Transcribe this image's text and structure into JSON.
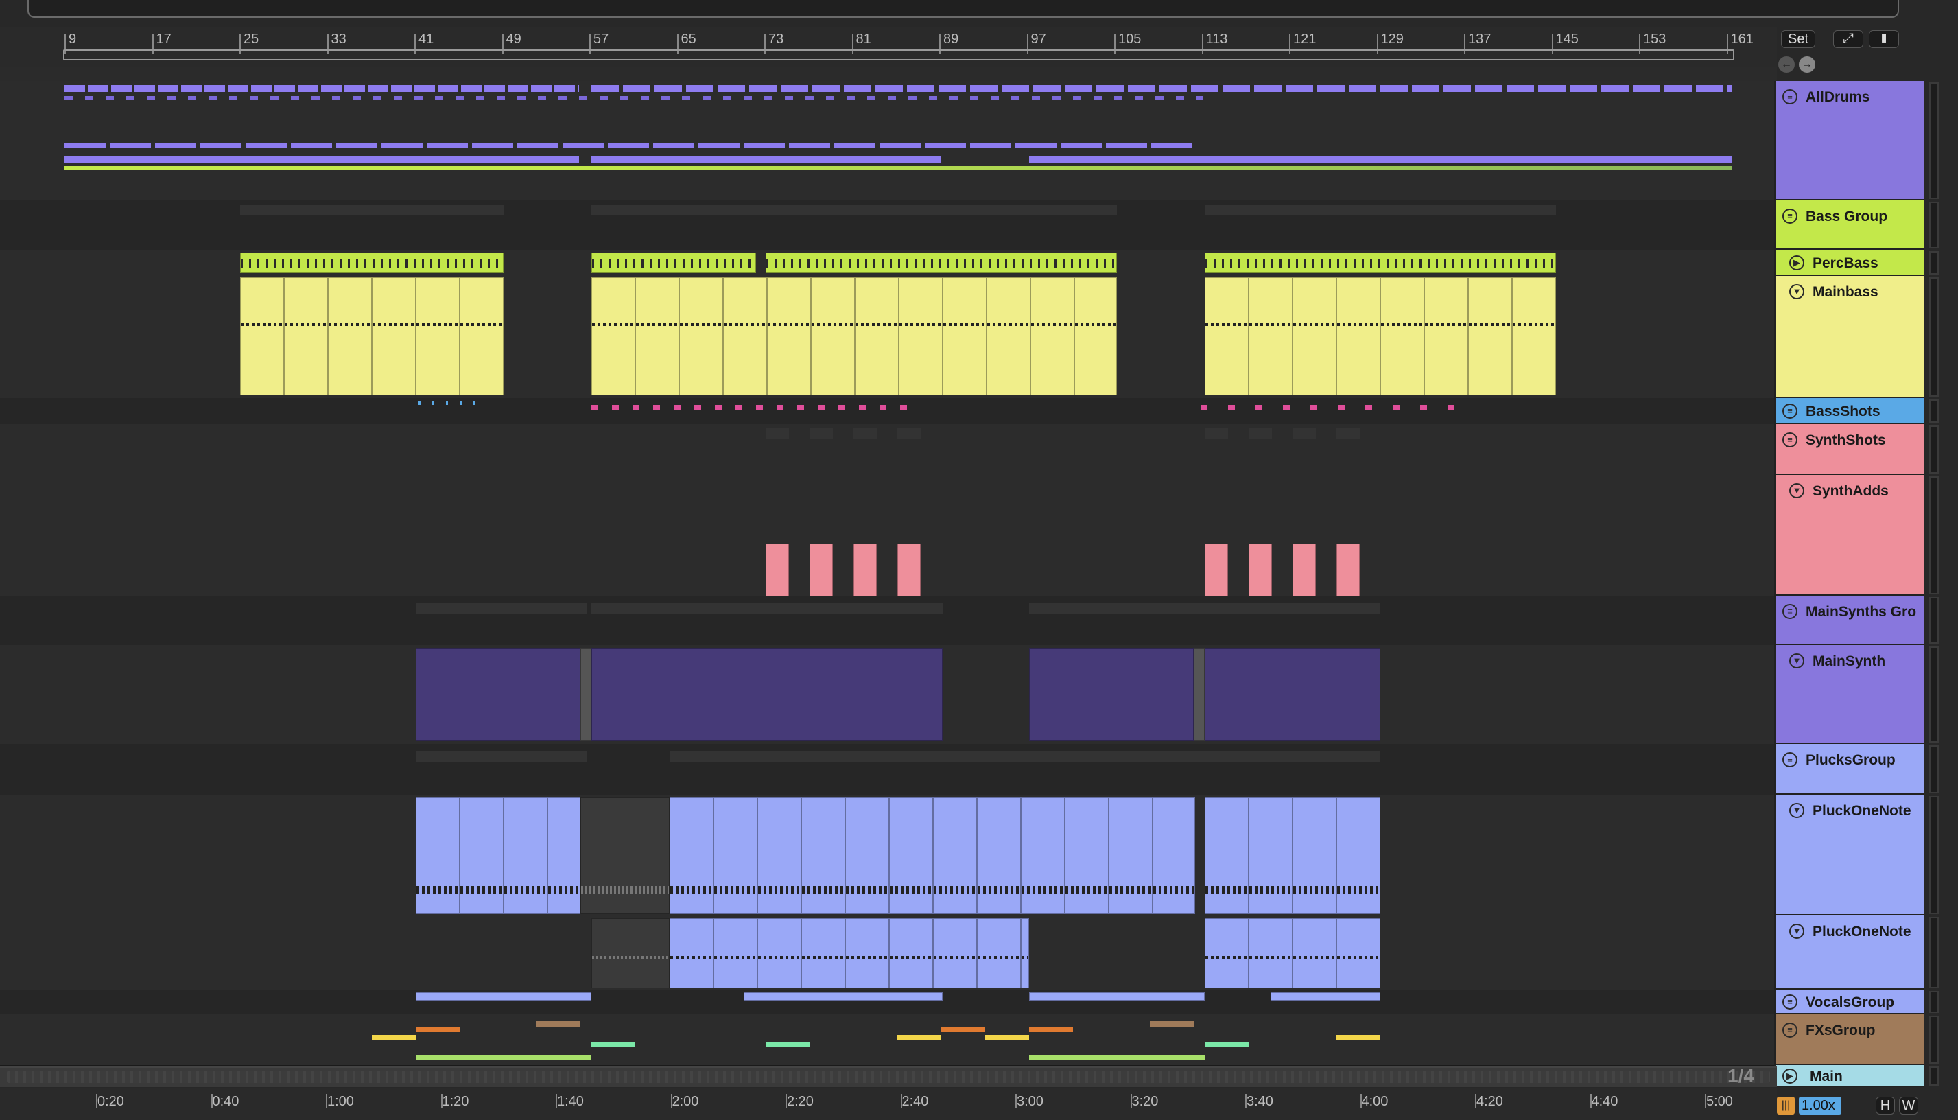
{
  "ruler": {
    "bars": [
      "9",
      "17",
      "25",
      "33",
      "41",
      "49",
      "57",
      "65",
      "73",
      "81",
      "89",
      "97",
      "105",
      "113",
      "121",
      "129",
      "137",
      "145",
      "153",
      "161"
    ]
  },
  "time_ruler": {
    "ticks": [
      "0:20",
      "0:40",
      "1:00",
      "1:20",
      "1:40",
      "2:00",
      "2:20",
      "2:40",
      "3:00",
      "3:20",
      "3:40",
      "4:00",
      "4:20",
      "4:40",
      "5:00"
    ]
  },
  "top_controls": {
    "set_label": "Set",
    "expand_icon": "expand-arrows-icon",
    "lock_icon": "lock-icon",
    "back_icon": "arrow-left-icon",
    "forward_icon": "arrow-right-icon"
  },
  "bottom_controls": {
    "page_indicator": "1/4",
    "zoom_label": "1.00x",
    "h_label": "H",
    "w_label": "W"
  },
  "tracks": [
    {
      "name": "AllDrums",
      "type": "group",
      "color": "#7b68d9"
    },
    {
      "name": "Bass Group",
      "type": "group",
      "color": "#c3e84a"
    },
    {
      "name": "PercBass",
      "type": "clip",
      "color": "#c3e84a"
    },
    {
      "name": "Mainbass",
      "type": "clip",
      "color": "#f0ee8a"
    },
    {
      "name": "BassShots",
      "type": "group",
      "color": "#5aa9e6"
    },
    {
      "name": "SynthShots",
      "type": "group",
      "color": "#ee8f9b"
    },
    {
      "name": "SynthAdds",
      "type": "clip",
      "color": "#ee8f9b"
    },
    {
      "name": "MainSynths Gro",
      "type": "group",
      "color": "#8877dd"
    },
    {
      "name": "MainSynth",
      "type": "clip",
      "color": "#8877dd"
    },
    {
      "name": "PlucksGroup",
      "type": "group",
      "color": "#9aa8f7"
    },
    {
      "name": "PluckOneNote",
      "type": "clip",
      "color": "#9aa8f7"
    },
    {
      "name": "PluckOneNote",
      "type": "clip",
      "color": "#9aa8f7"
    },
    {
      "name": "VocalsGroup",
      "type": "group",
      "color": "#9aa8f7"
    },
    {
      "name": "FXsGroup",
      "type": "group",
      "color": "#a07b5a"
    },
    {
      "name": "Main",
      "type": "master",
      "color": "#a5dbe6"
    }
  ]
}
